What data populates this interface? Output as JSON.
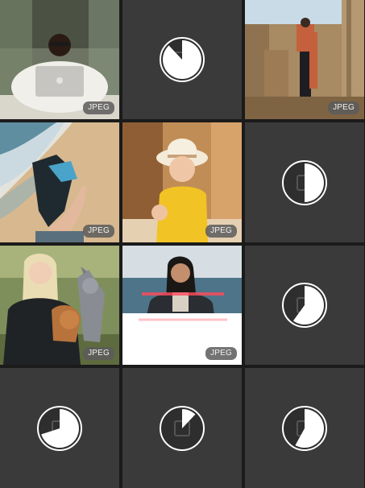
{
  "gallery": {
    "tiles": [
      {
        "kind": "photo",
        "scene": "person-laptop",
        "badge": "JPEG"
      },
      {
        "kind": "loading",
        "progress": 0.88
      },
      {
        "kind": "photo",
        "scene": "person-ruins",
        "badge": "JPEG"
      },
      {
        "kind": "photo",
        "scene": "hand-beach",
        "badge": "JPEG"
      },
      {
        "kind": "photo",
        "scene": "child-hat",
        "badge": "JPEG"
      },
      {
        "kind": "loading",
        "progress": 0.5
      },
      {
        "kind": "photo",
        "scene": "woman-dogs",
        "badge": "JPEG"
      },
      {
        "kind": "photo-partial",
        "scene": "woman-sea",
        "badge": "JPEG"
      },
      {
        "kind": "loading",
        "progress": 0.6
      },
      {
        "kind": "loading",
        "progress": 0.7
      },
      {
        "kind": "loading",
        "progress": 0.12
      },
      {
        "kind": "loading",
        "progress": 0.58
      }
    ]
  },
  "colors": {
    "tile_bg": "#3a3a3a",
    "gap": "#1b1b1b",
    "spinner_fill": "#ffffff",
    "badge_bg": "#5a5a5a"
  }
}
